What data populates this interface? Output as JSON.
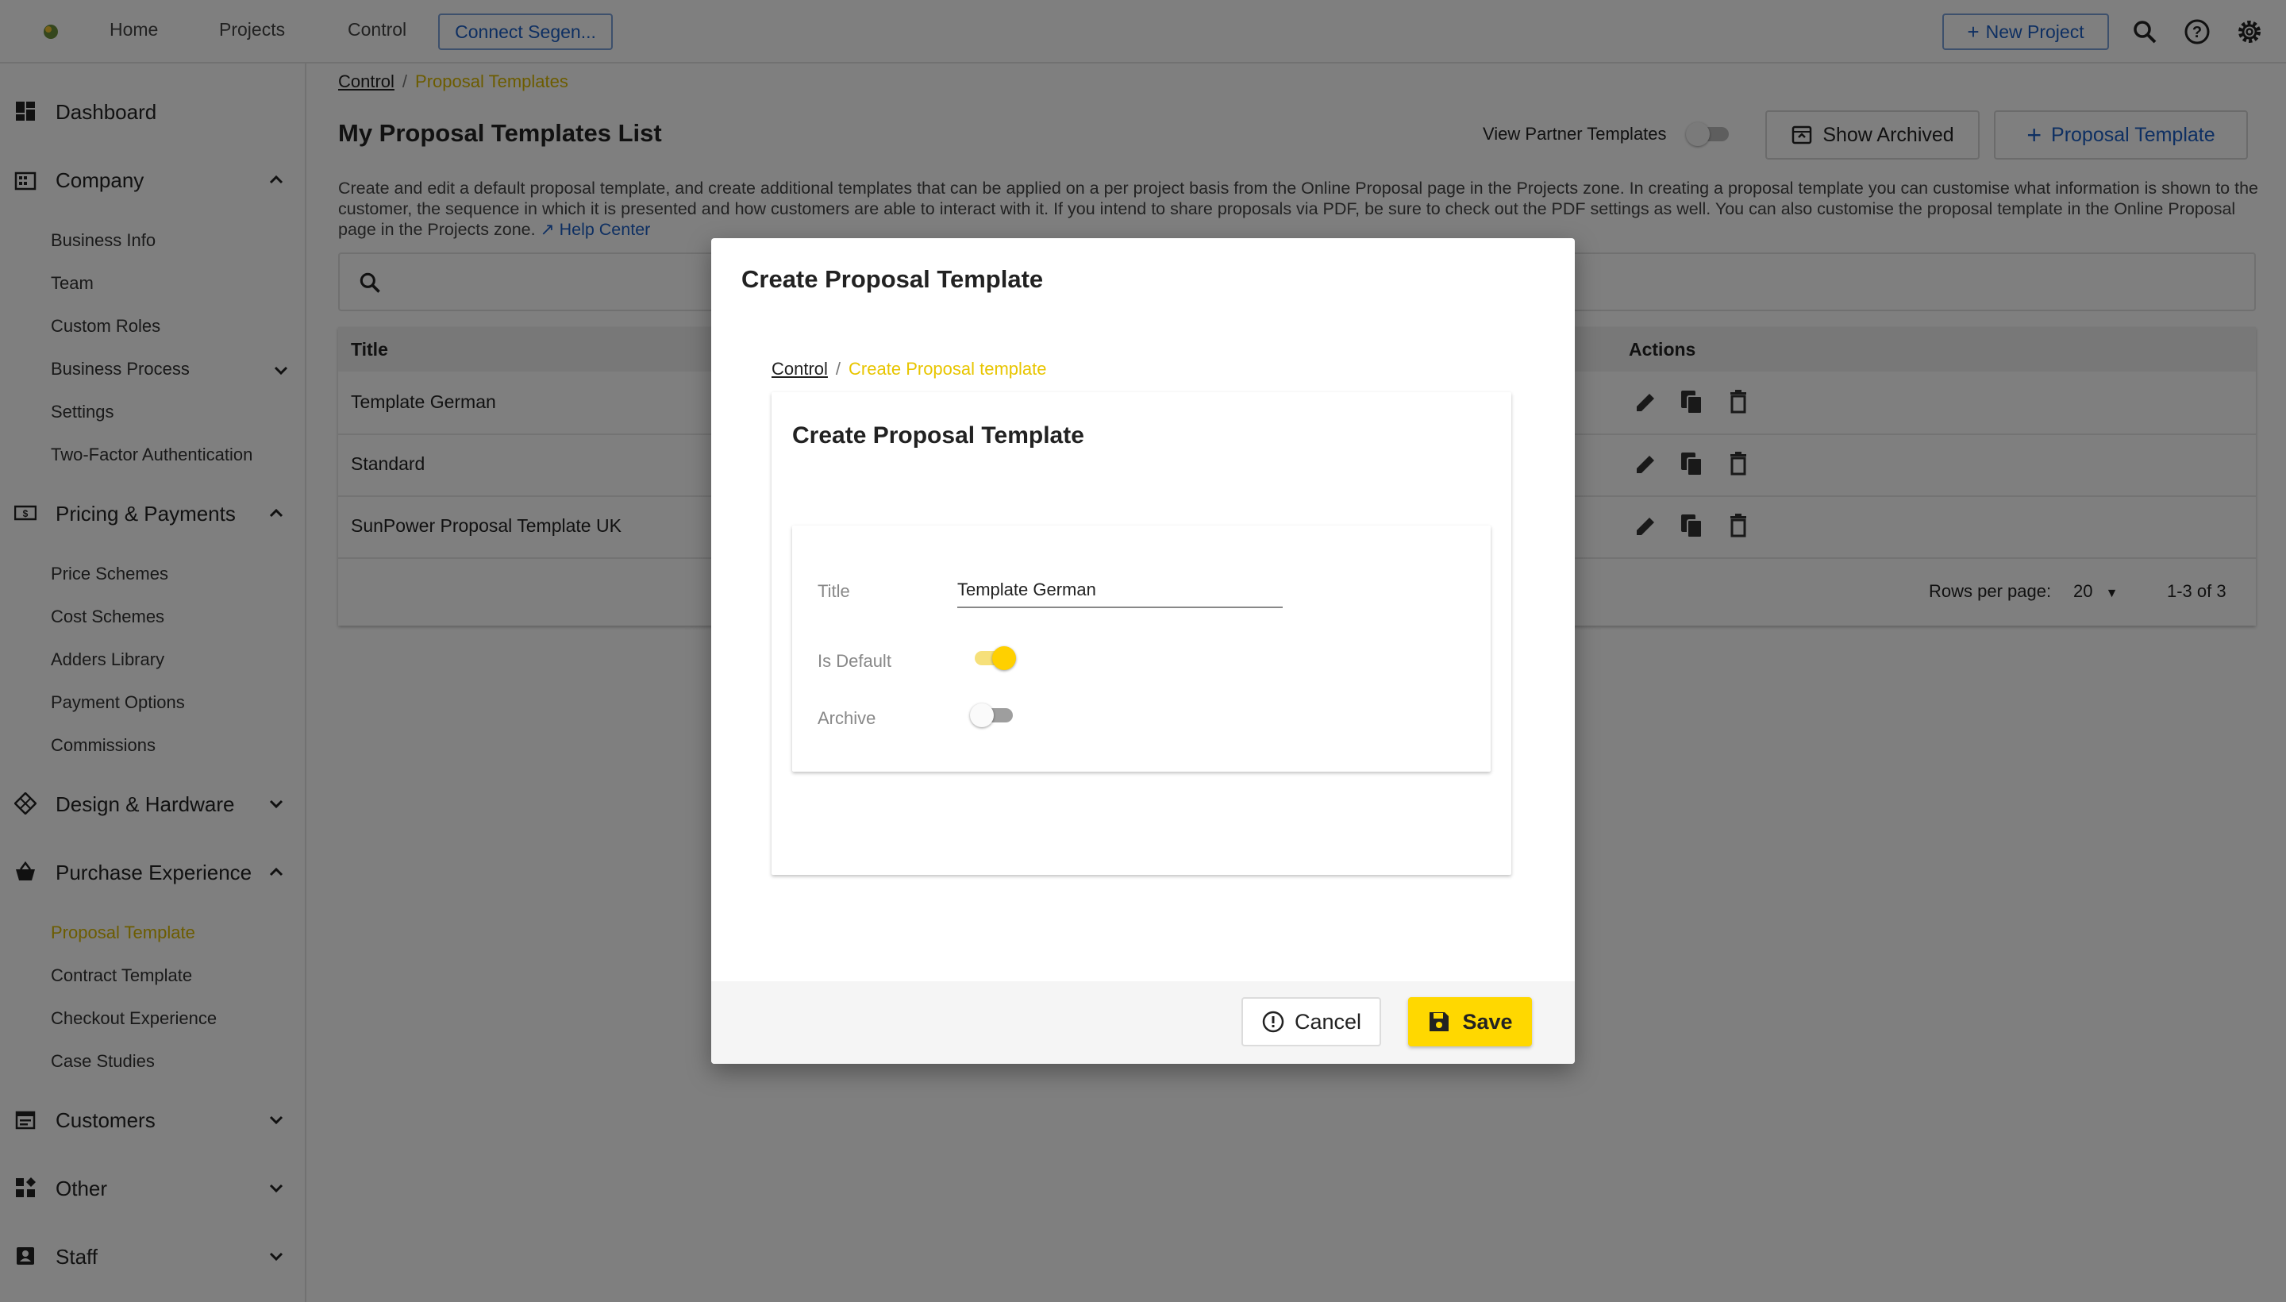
{
  "colors": {
    "accent": "#ffd800",
    "link": "#1c5fc4",
    "active_nav": "#d9b800"
  },
  "topnav": {
    "items": [
      "Home",
      "Projects",
      "Control"
    ],
    "connect_label": "Connect Segen...",
    "new_project_label": "New Project",
    "icons": [
      "search-icon",
      "help-icon",
      "gear-icon"
    ]
  },
  "sidebar": {
    "dashboard": "Dashboard",
    "company": {
      "label": "Company",
      "items": [
        "Business Info",
        "Team",
        "Custom Roles",
        "Business Process",
        "Settings",
        "Two-Factor Authentication"
      ]
    },
    "pricing": {
      "label": "Pricing & Payments",
      "items": [
        "Price Schemes",
        "Cost Schemes",
        "Adders Library",
        "Payment Options",
        "Commissions"
      ]
    },
    "design": {
      "label": "Design & Hardware"
    },
    "purchase": {
      "label": "Purchase Experience",
      "items": [
        "Proposal Template",
        "Contract Template",
        "Checkout Experience",
        "Case Studies"
      ],
      "active": "Proposal Template"
    },
    "customers": {
      "label": "Customers"
    },
    "other": {
      "label": "Other"
    },
    "staff": {
      "label": "Staff"
    }
  },
  "page": {
    "breadcrumb": {
      "parent": "Control",
      "current": "Proposal Templates"
    },
    "title": "My Proposal Templates List",
    "view_partner_label": "View Partner Templates",
    "view_partner_on": false,
    "show_archived_label": "Show Archived",
    "add_template_label": "Proposal Template",
    "description": "Create and edit a default proposal template, and create additional templates that can be applied on a per project basis from the Online Proposal page in the Projects zone. In creating a proposal template you can customise what information is shown to the customer, the sequence in which it is presented and how customers are able to interact with it. If you intend to share proposals via PDF, be sure to check out the PDF settings as well. You can also customise the proposal template in the Online Proposal page in the Projects zone.",
    "help_link": "Help Center"
  },
  "table": {
    "columns": {
      "title": "Title",
      "actions": "Actions"
    },
    "rows": [
      "Template German",
      "Standard",
      "SunPower Proposal Template UK"
    ],
    "rows_per_page_label": "Rows per page:",
    "rows_per_page": "20",
    "range": "1-3 of 3"
  },
  "dialog": {
    "title": "Create Proposal Template",
    "breadcrumb": {
      "parent": "Control",
      "current": "Create Proposal template"
    },
    "card_title": "Create Proposal Template",
    "fields": {
      "title_label": "Title",
      "title_value": "Template German",
      "is_default_label": "Is Default",
      "is_default": true,
      "archive_label": "Archive",
      "archive": false
    },
    "cancel_label": "Cancel",
    "save_label": "Save"
  }
}
